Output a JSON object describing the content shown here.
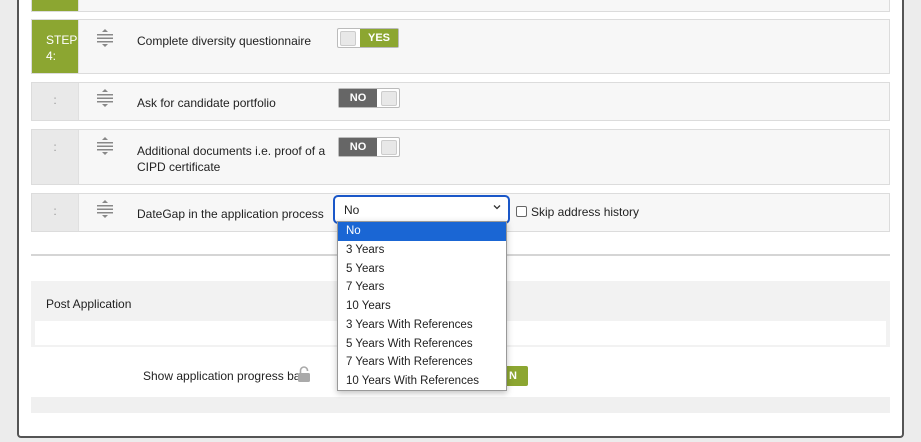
{
  "rows": [
    {
      "step_line1": "STEP",
      "step_line2": "4:",
      "label": "Complete diversity questionnaire",
      "toggle": "YES"
    },
    {
      "step": ":",
      "label": "Ask for candidate portfolio",
      "toggle": "NO"
    },
    {
      "step": ":",
      "label_line1": "Additional documents i.e. proof of a",
      "label_line2": "CIPD certificate",
      "toggle": "NO"
    },
    {
      "step": ":",
      "label": "DateGap in the application process"
    }
  ],
  "dategap_select": {
    "value": "No",
    "options": [
      "No",
      "3 Years",
      "5 Years",
      "7 Years",
      "10 Years",
      "3 Years With References",
      "5 Years With References",
      "7 Years With References",
      "10 Years With References"
    ]
  },
  "skip_address_history": "Skip address history",
  "post_application": {
    "title": "Post Application",
    "progress_label": "Show application progress bar",
    "progress_toggle_partial": "N"
  },
  "colors": {
    "green": "#8ca631",
    "dark_toggle": "#666666",
    "select_blue": "#1a66d4"
  }
}
